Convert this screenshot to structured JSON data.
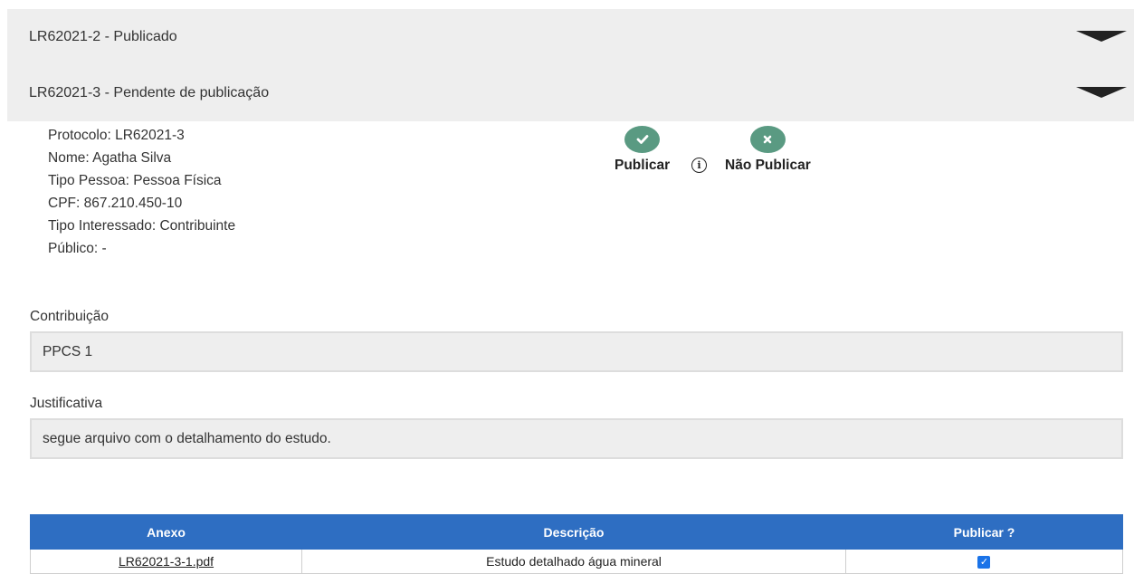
{
  "accordion": [
    {
      "title": "LR62021-2 - Publicado"
    },
    {
      "title": "LR62021-3 - Pendente de publicação"
    }
  ],
  "details": {
    "protocolo": "Protocolo: LR62021-3",
    "nome": "Nome: Agatha Silva",
    "tipo_pessoa": "Tipo Pessoa: Pessoa Física",
    "cpf": "CPF: 867.210.450-10",
    "tipo_interessado": "Tipo Interessado: Contribuinte",
    "publico": "Público: -"
  },
  "actions": {
    "publicar_label": "Publicar",
    "nao_publicar_label": "Não Publicar",
    "publicar_icon": "check-icon",
    "nao_publicar_icon": "x-icon",
    "info_icon": "info-icon"
  },
  "contribuicao": {
    "label": "Contribuição",
    "value": "PPCS 1"
  },
  "justificativa": {
    "label": "Justificativa",
    "value": "segue arquivo com o detalhamento do estudo."
  },
  "attachments": {
    "headers": {
      "anexo": "Anexo",
      "descricao": "Descrição",
      "publicar": "Publicar ?"
    },
    "rows": [
      {
        "file": "LR62021-3-1.pdf",
        "description": "Estudo detalhado água mineral",
        "publish": true
      }
    ]
  },
  "colors": {
    "accent": "#2e6ec2",
    "action_green": "#5a9a82",
    "panel_gray": "#eeeeee"
  }
}
